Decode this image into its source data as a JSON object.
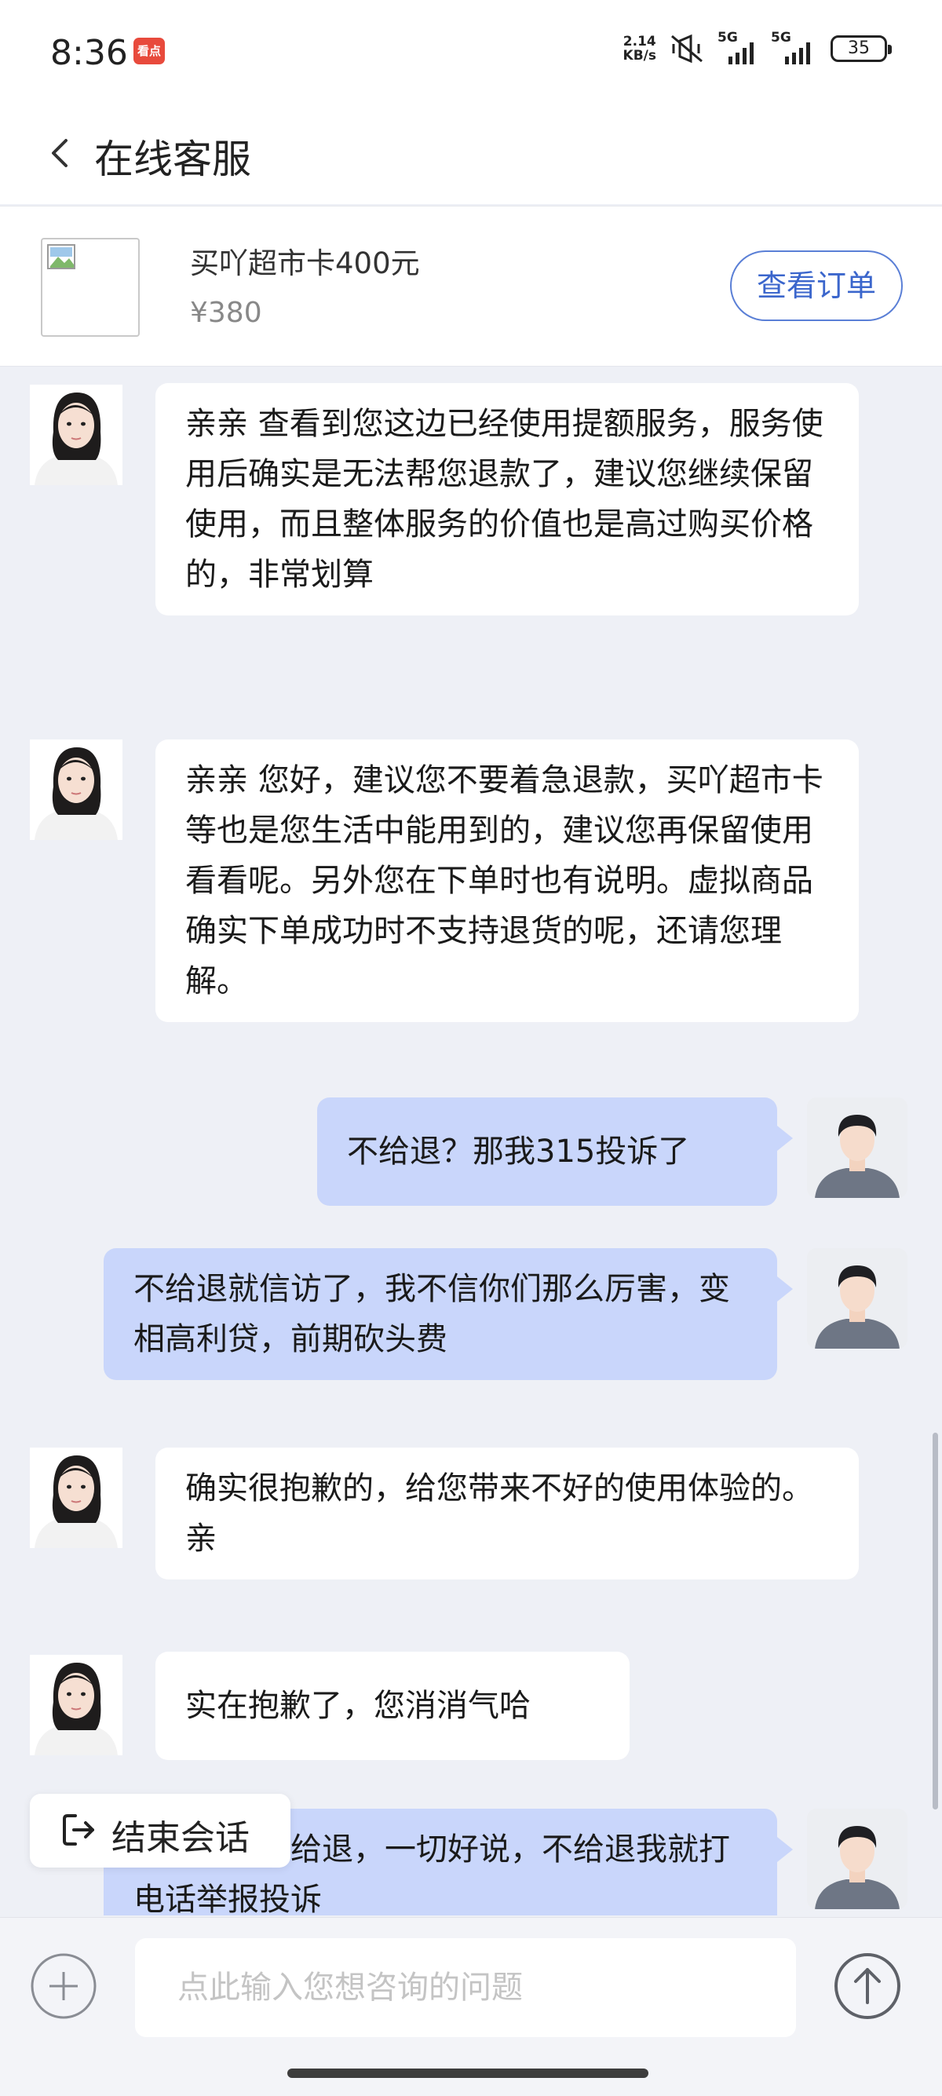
{
  "status_bar": {
    "time": "8:36",
    "app_badge": "看点",
    "net_speed_value": "2.14",
    "net_speed_unit": "KB/s",
    "signal_label_1": "5G",
    "signal_label_2": "5G",
    "battery": "35"
  },
  "header": {
    "title": "在线客服"
  },
  "product": {
    "name": "买吖超市卡400元",
    "price": "¥380",
    "order_button": "查看订单"
  },
  "messages": [
    {
      "sender": "agent",
      "text": "亲亲 查看到您这边已经使用提额服务，服务使用后确实是无法帮您退款了，建议您继续保留使用，而且整体服务的价值也是高过购买价格的，非常划算"
    },
    {
      "sender": "agent",
      "text": "亲亲 您好，建议您不要着急退款，买吖超市卡等也是您生活中能用到的，建议您再保留使用看看呢。另外您在下单时也有说明。虚拟商品确实下单成功时不支持退货的呢，还请您理解。"
    },
    {
      "sender": "user",
      "text": "不给退？那我315投诉了"
    },
    {
      "sender": "user",
      "text": "不给退就信访了，我不信你们那么厉害，变相高利贷，前期砍头费"
    },
    {
      "sender": "agent",
      "text": "确实很抱歉的，给您带来不好的使用体验的。亲"
    },
    {
      "sender": "agent",
      "text": "实在抱歉了，您消消气哈"
    },
    {
      "sender": "user",
      "text": "你要是现在给退，一切好说，不给退我就打电话举报投诉"
    }
  ],
  "end_session": {
    "label": "结束会话"
  },
  "input": {
    "placeholder": "点此输入您想咨询的问题",
    "value": ""
  },
  "colors": {
    "page_background": "#eef0f6",
    "user_bubble": "#c9d6fb",
    "agent_bubble": "#ffffff",
    "accent": "#3b66cc"
  }
}
